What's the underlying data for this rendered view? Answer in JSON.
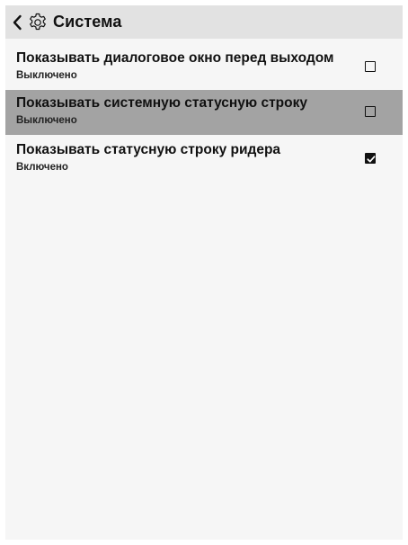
{
  "header": {
    "back_icon": "chevron-left-icon",
    "section_icon": "gear-icon",
    "title": "Система"
  },
  "settings": [
    {
      "title": "Показывать диалоговое окно перед выходом",
      "status": "Выключено",
      "checked": false,
      "selected": false
    },
    {
      "title": "Показывать системную статусную строку",
      "status": "Выключено",
      "checked": false,
      "selected": true
    },
    {
      "title": "Показывать статусную строку ридера",
      "status": "Включено",
      "checked": true,
      "selected": false
    }
  ],
  "colors": {
    "background": "#f6f6f6",
    "header_bg": "#e2e2e2",
    "selected_row_bg": "#a3a3a3",
    "text": "#111111"
  }
}
